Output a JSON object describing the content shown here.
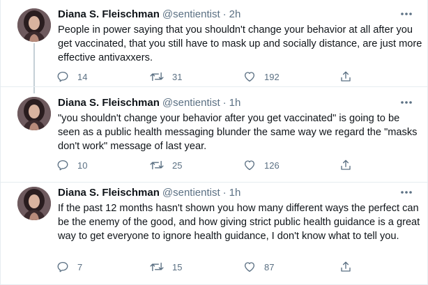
{
  "tweets": [
    {
      "name": "Diana S. Fleischman",
      "handle": "@sentientist",
      "separator": "·",
      "time": "2h",
      "text": "People in power saying that you shouldn't change your behavior at all after you get vaccinated, that you still have to mask up and socially distance, are just more effective antivaxxers.",
      "replies": "14",
      "retweets": "31",
      "likes": "192"
    },
    {
      "name": "Diana S. Fleischman",
      "handle": "@sentientist",
      "separator": "·",
      "time": "1h",
      "text": "\"you shouldn't change your behavior after you get vaccinated\" is going to be seen as a public health messaging blunder the same way we regard the \"masks don't work\" message of last year.",
      "replies": "10",
      "retweets": "25",
      "likes": "126"
    },
    {
      "name": "Diana S. Fleischman",
      "handle": "@sentientist",
      "separator": "·",
      "time": "1h",
      "text": "If the past 12 months hasn't shown you how many different ways the perfect can be the enemy of the good, and how giving strict public health guidance is a great way to get everyone to ignore health guidance, I don't know what to tell you.",
      "replies": "7",
      "retweets": "15",
      "likes": "87"
    }
  ],
  "icons": {
    "more": "more-horizontal-icon",
    "reply": "reply-icon",
    "retweet": "retweet-icon",
    "like": "heart-icon",
    "share": "share-icon"
  },
  "colors": {
    "text": "#0f1419",
    "secondary": "#5b7083",
    "border": "#e6ecf0",
    "thread_line": "#c4cfd6"
  }
}
